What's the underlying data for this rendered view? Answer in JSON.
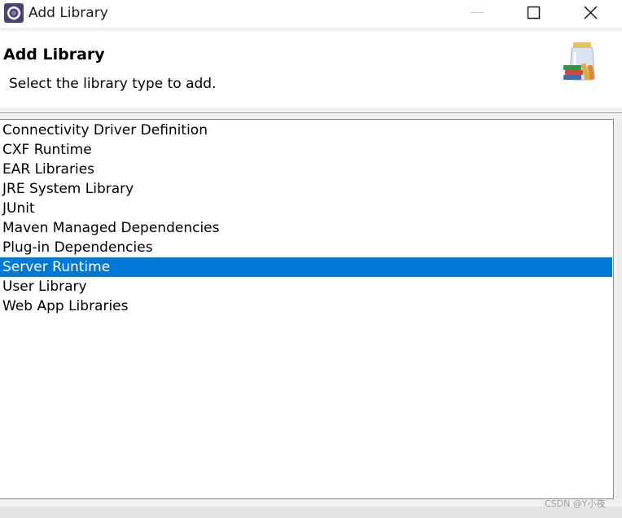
{
  "window": {
    "title": "Add Library",
    "app_icon": "eclipse-icon",
    "controls": [
      "minimize-icon",
      "maximize-icon",
      "close-icon"
    ]
  },
  "header": {
    "title": "Add Library",
    "description": "Select the library type to add.",
    "banner_icon": "library-jars-icon"
  },
  "library_list": {
    "items": [
      "Connectivity Driver Definition",
      "CXF Runtime",
      "EAR Libraries",
      "JRE System Library",
      "JUnit",
      "Maven Managed Dependencies",
      "Plug-in Dependencies",
      "Server Runtime",
      "User Library",
      "Web App Libraries"
    ],
    "selected_index": 7
  },
  "colors": {
    "selection": "#0078d7",
    "selection_text": "#ffffff",
    "header_bg": "#ffffff",
    "dialog_bg": "#f0f0f0"
  },
  "watermark": "CSDN @Y小夜"
}
